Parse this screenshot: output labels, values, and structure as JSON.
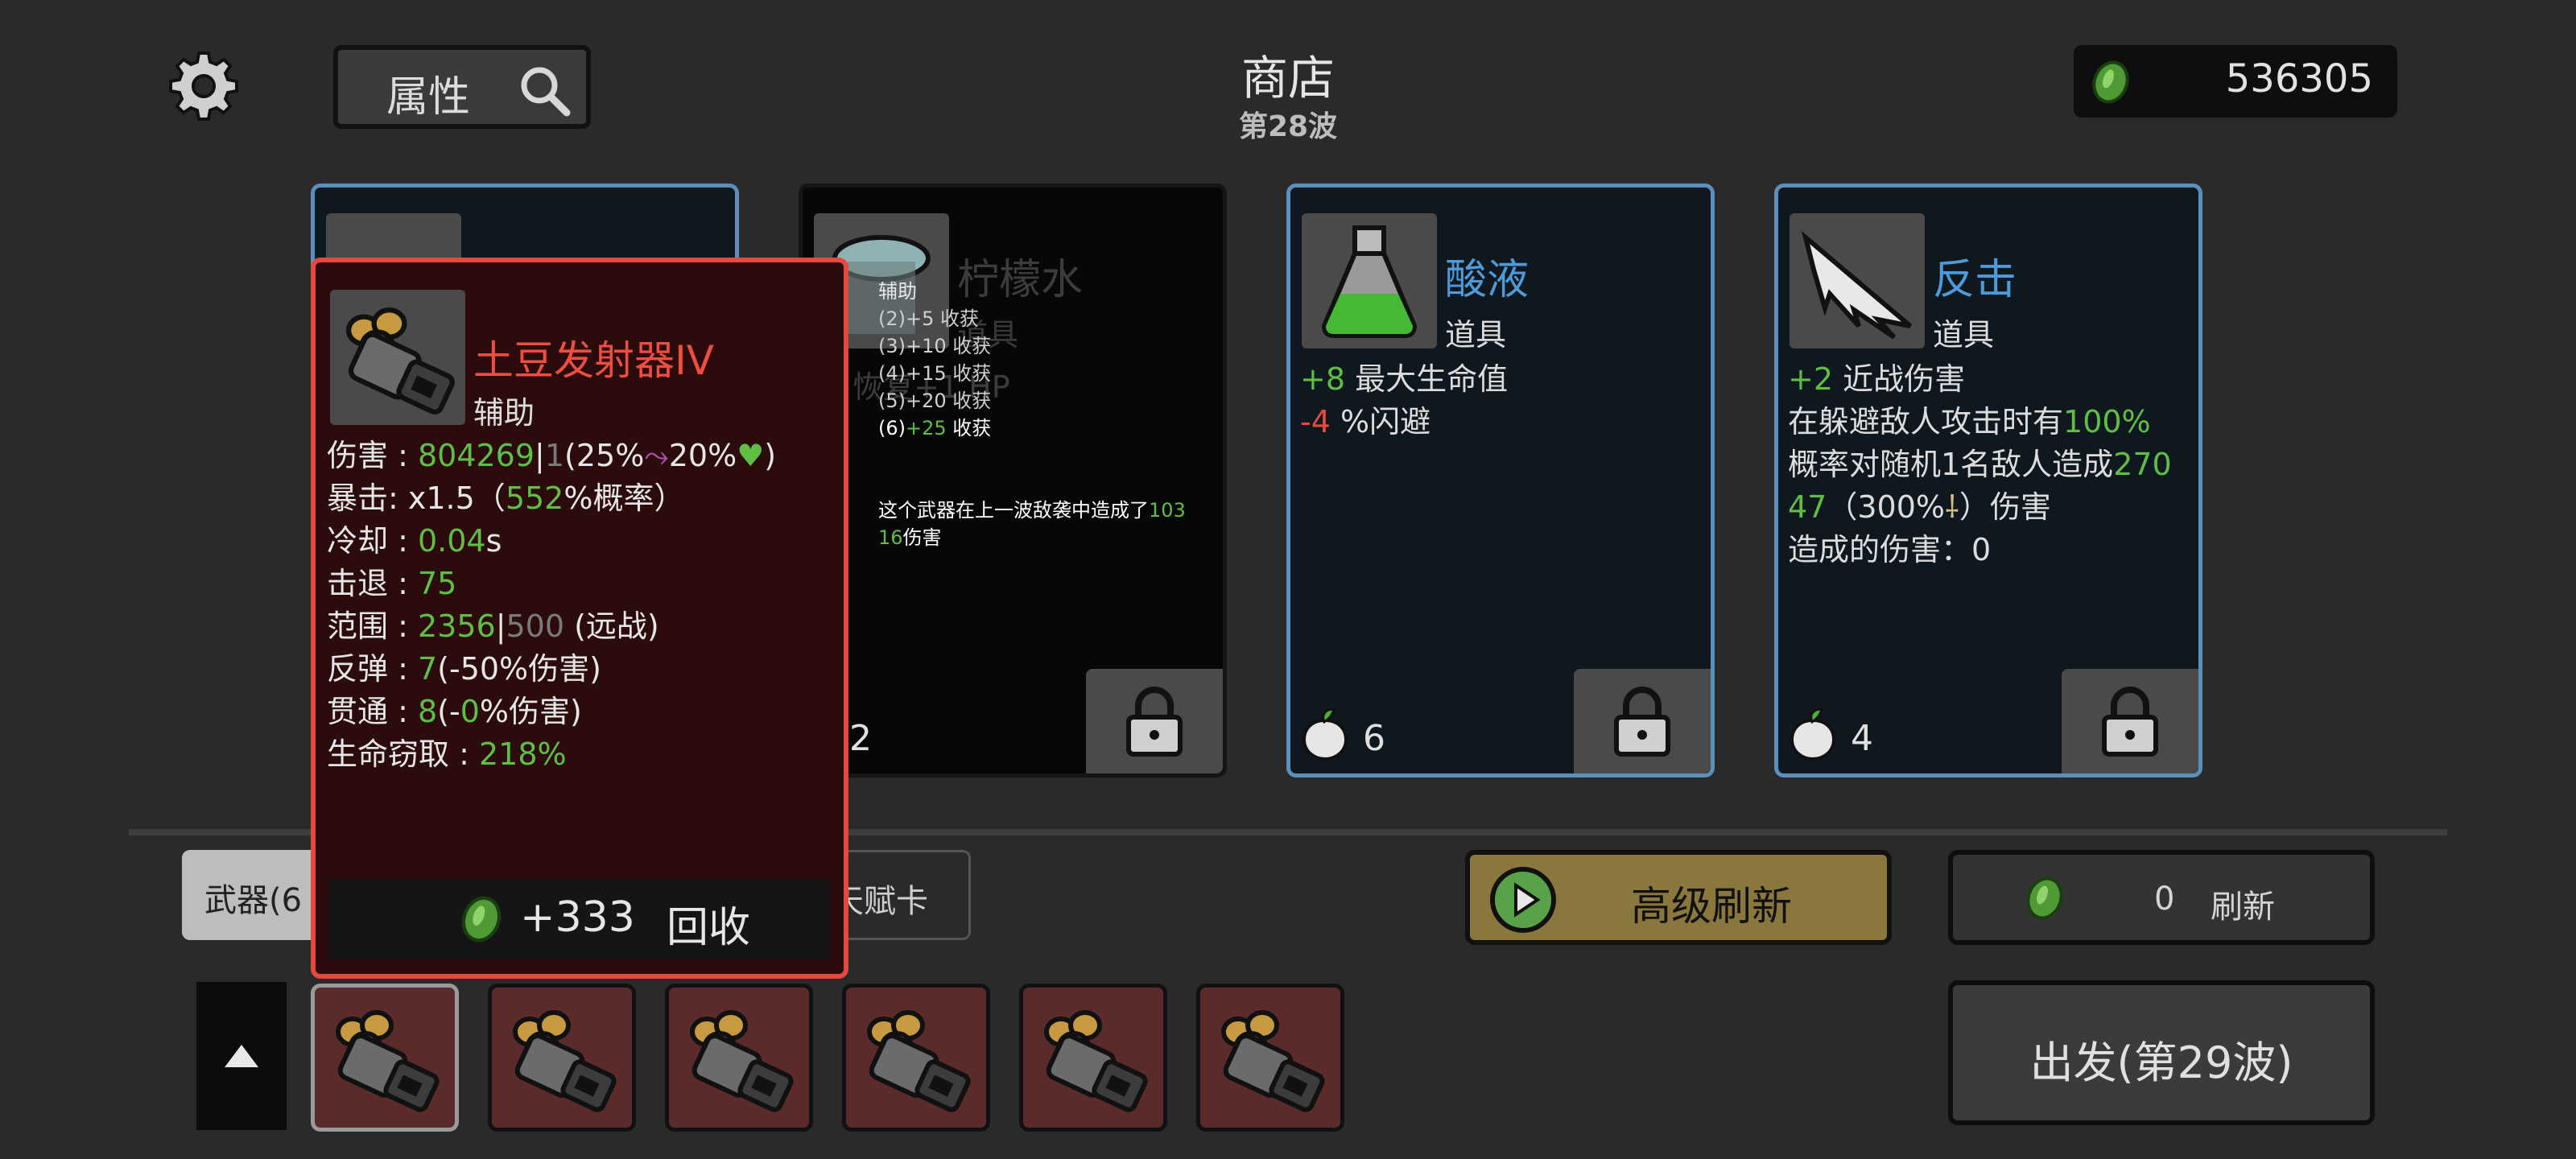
{
  "header": {
    "search_label": "属性",
    "title": "商店",
    "wave": "第28波",
    "currency": "536305"
  },
  "cards": [
    {
      "name": "柠檬水",
      "type": "道具",
      "visible_fragment": "用 恢复+1 HP",
      "count": "2",
      "set_popup": {
        "title": "辅助",
        "lines": [
          "(2)+5 收获",
          "(3)+10 收获",
          "(4)+15 收获",
          "(5)+20 收获"
        ],
        "active_prefix": "(6)",
        "active_value": "+25",
        "active_suffix": " 收获",
        "dmg_prefix": "这个武器在上一波敌袭中造成了",
        "dmg_value_a": "103",
        "dmg_value_b": "16",
        "dmg_suffix": "伤害"
      }
    },
    {
      "name": "酸液",
      "type": "道具",
      "line1_value": "+8",
      "line1_text": " 最大生命值",
      "line2_value": "-4",
      "line2_text": " %闪避",
      "count": "6"
    },
    {
      "name": "反击",
      "type": "道具",
      "line1_value": "+2",
      "line1_text": " 近战伤害",
      "line2_text": "在躲避敌人攻击时有",
      "line2_value": "100%",
      "line3_text": "概率对随机1名敌人造成",
      "line3_value": "270",
      "line4_value": "47",
      "line4_text_a": "（300%",
      "line4_text_b": "）伤害",
      "line5_text": "造成的伤害：0",
      "count": "4"
    }
  ],
  "tooltip": {
    "name": "土豆发射器IV",
    "type": "辅助",
    "damage_label": "伤害 : ",
    "damage_value": "804269",
    "damage_sep": "|",
    "damage_base": "1",
    "damage_scaling": "(25%",
    "damage_scaling2": "20%",
    "damage_close": ")",
    "crit_label": "暴击:  x1.5（",
    "crit_value": "552",
    "crit_suffix": "%概率）",
    "cooldown_label": "冷却 : ",
    "cooldown_value": "0.04",
    "cooldown_unit": "s",
    "knockback_label": "击退 : ",
    "knockback_value": "75",
    "range_label": "范围 : ",
    "range_value": "2356",
    "range_sep": "|",
    "range_base": "500",
    "range_suffix": " (远战)",
    "bounce_label": "反弹 : ",
    "bounce_value": "7",
    "bounce_suffix": "(-50%伤害)",
    "pierce_label": "贯通 : ",
    "pierce_value": "8",
    "pierce_mid": "(-",
    "pierce_value2": "0",
    "pierce_suffix": "%伤害)",
    "lifesteal_label": "生命窃取 : ",
    "lifesteal_value": "218%",
    "sell_amount": "+333",
    "sell_label": "回收"
  },
  "bottom": {
    "tab_weapons": "武器(6",
    "tab_talent": "天赋卡",
    "adv_refresh": "高级刷新",
    "refresh_cost": "0",
    "refresh_label": "刷新",
    "go_button": "出发(第29波)"
  },
  "colors": {
    "positive": "#5fbf45",
    "negative": "#e64a3c",
    "item_name": "#4f9bd9",
    "weapon_name": "#ee4e40",
    "card_border": "#5c8fba",
    "tooltip_border": "#e5483f",
    "adv_refresh_bg": "#8a773d"
  },
  "icons": [
    "settings-gear-icon",
    "search-icon",
    "coin-icon",
    "potato-launcher-icon",
    "lemonade-icon",
    "acid-flask-icon",
    "counterattack-icon",
    "tier-fruit-icon",
    "lock-icon",
    "play-icon",
    "up-arrow-icon"
  ]
}
